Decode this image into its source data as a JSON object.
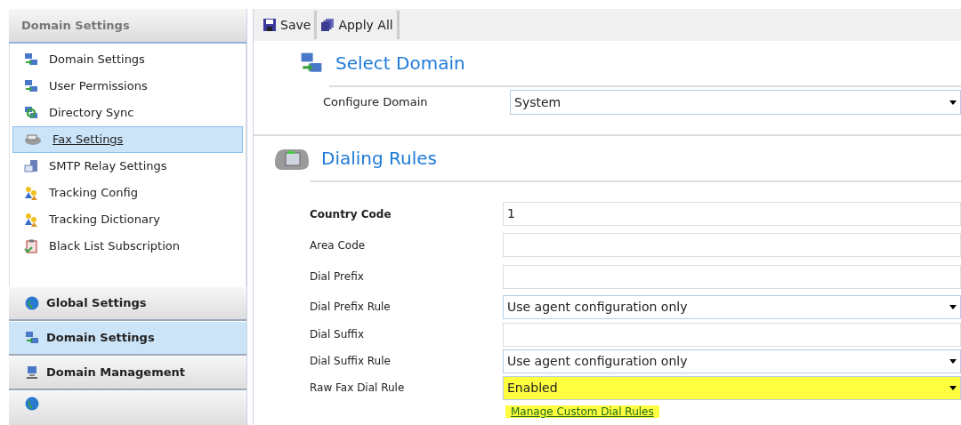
{
  "sidebar": {
    "title": "Domain Settings",
    "items": [
      {
        "label": "Domain Settings",
        "selected": false
      },
      {
        "label": "User Permissions",
        "selected": false
      },
      {
        "label": "Directory Sync",
        "selected": false
      },
      {
        "label": "Fax Settings",
        "selected": true
      },
      {
        "label": "SMTP Relay Settings",
        "selected": false
      },
      {
        "label": "Tracking Config",
        "selected": false
      },
      {
        "label": "Tracking Dictionary",
        "selected": false
      },
      {
        "label": "Black List Subscription",
        "selected": false
      }
    ],
    "nav": [
      {
        "label": "Global Settings",
        "selected": false
      },
      {
        "label": "Domain Settings",
        "selected": true
      },
      {
        "label": "Domain Management",
        "selected": false
      }
    ]
  },
  "toolbar": [
    {
      "label": "Save"
    },
    {
      "label": "Apply All"
    }
  ],
  "select_domain": {
    "title": "Select Domain",
    "label": "Configure Domain",
    "value": "System"
  },
  "dialing_rules": {
    "title": "Dialing Rules",
    "fields": [
      {
        "label": "Country Code",
        "kind": "text",
        "value": "1",
        "required": true,
        "highlighted": false
      },
      {
        "label": "Area Code",
        "kind": "text",
        "required": false,
        "highlighted": false
      },
      {
        "label": "Dial Prefix",
        "kind": "text",
        "required": false,
        "highlighted": false
      },
      {
        "label": "Dial Prefix Rule",
        "kind": "select",
        "value": "Use agent configuration only",
        "required": false,
        "highlighted": false
      },
      {
        "label": "Dial Suffix",
        "kind": "text",
        "required": false,
        "highlighted": false
      },
      {
        "label": "Dial Suffix Rule",
        "kind": "select",
        "value": "Use agent configuration only",
        "required": false,
        "highlighted": false
      },
      {
        "label": "Raw Fax Dial Rule",
        "kind": "select",
        "value": "Enabled",
        "required": false,
        "highlighted": true
      }
    ],
    "link": {
      "label": "Manage Custom Dial Rules",
      "highlighted": true
    }
  }
}
